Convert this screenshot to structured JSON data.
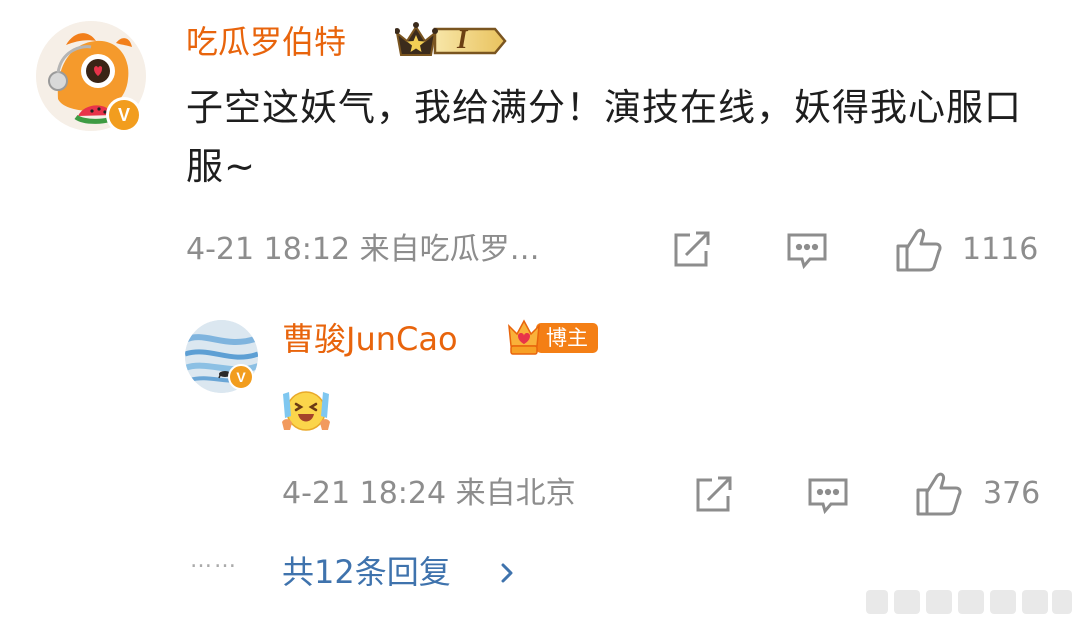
{
  "comment": {
    "username": "吃瓜罗伯特",
    "level_badge_text": "I",
    "text": "子空这妖气，我给满分！演技在线，妖得我心服口服~",
    "meta": "4-21 18:12 来自吃瓜罗…",
    "like_count": "1116"
  },
  "reply": {
    "username": "曹骏JunCao",
    "badge_text": "博主",
    "meta": "4-21 18:24 来自北京",
    "like_count": "376"
  },
  "more_replies": {
    "dots": "……",
    "label": "共12条回复"
  },
  "colors": {
    "username": "#e8640c",
    "meta": "#8d8d8d",
    "link": "#3f73ad",
    "verified": "#f29d1e"
  },
  "icons": {
    "share": "share-icon",
    "comment": "comment-icon",
    "like": "thumbs-up-icon",
    "chevron": "chevron-right-icon"
  }
}
